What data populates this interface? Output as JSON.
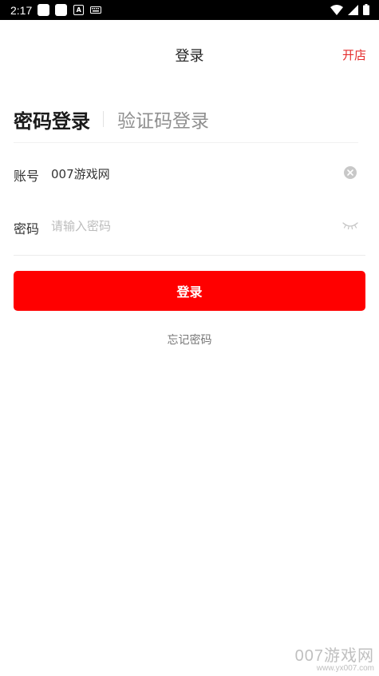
{
  "status_bar": {
    "time": "2:17",
    "icons": [
      "notification-square-icon",
      "notification-square-icon",
      "a-box-icon",
      "keyboard-icon",
      "wifi-icon",
      "signal-icon",
      "battery-icon"
    ]
  },
  "header": {
    "title": "登录",
    "open_store": "开店"
  },
  "tabs": {
    "active": "密码登录",
    "inactive": "验证码登录"
  },
  "form": {
    "account_label": "账号",
    "account_value": "007游戏网",
    "password_label": "密码",
    "password_placeholder": "请输入密码"
  },
  "buttons": {
    "login": "登录",
    "forgot": "忘记密码"
  },
  "watermark": {
    "brand": "007游戏网",
    "url": "www.yx007.com"
  },
  "colors": {
    "accent": "#ff0000",
    "open_store": "#e42c2c"
  }
}
